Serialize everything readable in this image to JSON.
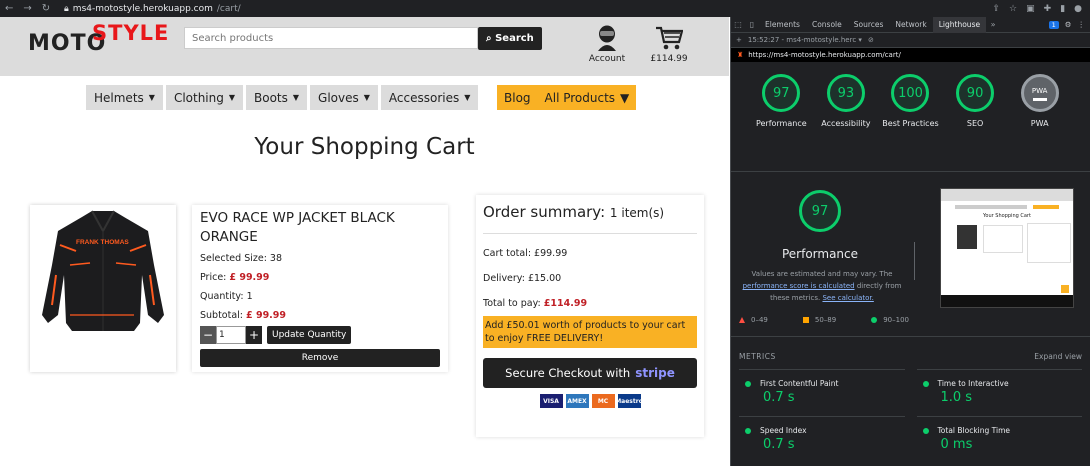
{
  "browser": {
    "url_host": "ms4-motostyle.herokuapp.com",
    "url_path": "/cart/"
  },
  "site": {
    "logo_part1": "MOTO",
    "logo_part2": "STYLE",
    "search_placeholder": "Search products",
    "search_button": "Search",
    "account_label": "Account",
    "bag_total": "£114.99",
    "nav_items": [
      "Helmets",
      "Clothing",
      "Boots",
      "Gloves",
      "Accessories"
    ],
    "blog_label": "Blog",
    "all_products_label": "All Products",
    "page_title": "Your Shopping Cart",
    "product": {
      "name": "EVO RACE WP JACKET BLACK ORANGE",
      "brand_print": "FRANK THOMAS",
      "size_label": "Selected Size: 38",
      "price_label": "Price:",
      "price": "£ 99.99",
      "quantity_label": "Quantity: 1",
      "subtotal_label": "Subtotal:",
      "subtotal": "£ 99.99",
      "qty_value": "1",
      "update_button": "Update Quantity",
      "remove_button": "Remove",
      "minus": "−",
      "plus": "+"
    },
    "summary": {
      "title": "Order summary:",
      "count": "1 item(s)",
      "cart_total": "Cart total: £99.99",
      "delivery": "Delivery: £15.00",
      "total_label": "Total to pay:",
      "total": "£114.99",
      "free_delivery": "Add £50.01 worth of products to your cart to enjoy FREE DELIVERY!",
      "checkout_text": "Secure Checkout with",
      "checkout_brand": "stripe",
      "cards": [
        "VISA",
        "AMEX",
        "MC",
        "Maestro"
      ]
    }
  },
  "devtools": {
    "tabs": [
      "Elements",
      "Console",
      "Sources",
      "Network",
      "Lighthouse"
    ],
    "active_tab": "Lighthouse",
    "issue_count": "1",
    "report_time": "15:52:27 - ms4-motostyle.herc ▾",
    "report_url": "https://ms4-motostyle.herokuapp.com/cart/",
    "scores": [
      {
        "label": "Performance",
        "value": "97"
      },
      {
        "label": "Accessibility",
        "value": "93"
      },
      {
        "label": "Best Practices",
        "value": "100"
      },
      {
        "label": "SEO",
        "value": "90"
      },
      {
        "label": "PWA",
        "value": "PWA"
      }
    ],
    "perf_score": "97",
    "perf_title": "Performance",
    "perf_note_1": "Values are estimated and may vary. The",
    "perf_note_link": "performance score is calculated",
    "perf_note_2": "directly from these metrics.",
    "perf_note_calc": "See calculator.",
    "legend": [
      "0–49",
      "50–89",
      "90–100"
    ],
    "metrics_heading": "METRICS",
    "expand_view": "Expand view",
    "metrics": [
      {
        "label": "First Contentful Paint",
        "value": "0.7 s"
      },
      {
        "label": "Time to Interactive",
        "value": "1.0 s"
      },
      {
        "label": "Speed Index",
        "value": "0.7 s"
      },
      {
        "label": "Total Blocking Time",
        "value": "0 ms"
      }
    ],
    "colors": {
      "pass": "#0cce6b",
      "average": "#ffa400",
      "fail": "#ff4e42"
    }
  }
}
